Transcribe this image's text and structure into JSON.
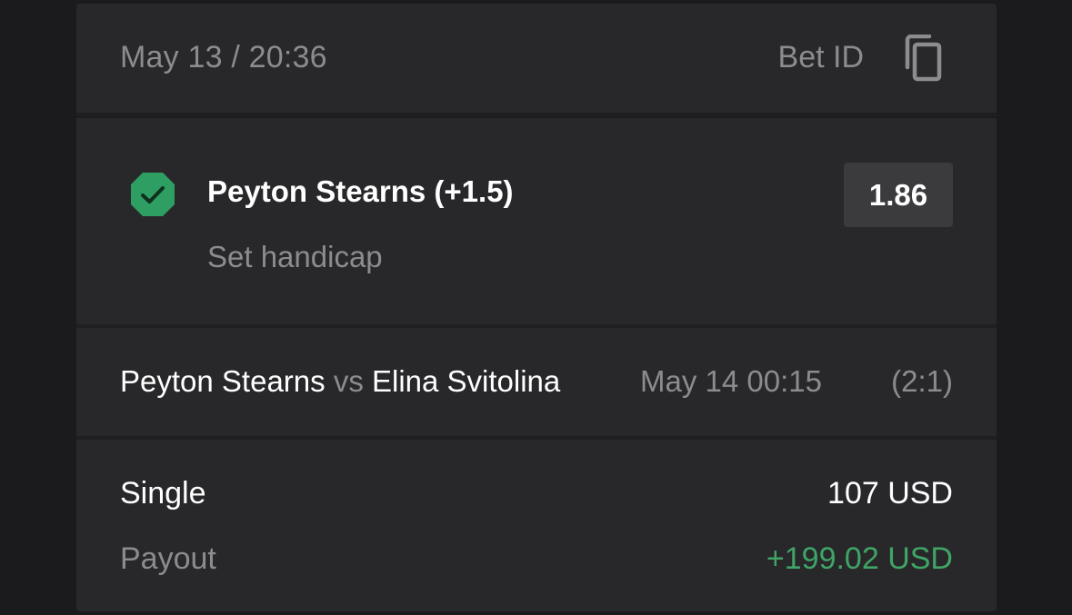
{
  "header": {
    "placed_at": "May 13 / 20:36",
    "bet_id_label": "Bet ID",
    "copy_icon": "copy-icon"
  },
  "selection": {
    "status_icon": "check-octagon-icon",
    "status_color": "#2e9e62",
    "name": "Peyton Stearns (+1.5)",
    "market": "Set handicap",
    "odds": "1.86"
  },
  "event": {
    "home": "Peyton Stearns",
    "vs": "vs",
    "away": "Elina Svitolina",
    "start": "May 14 00:15",
    "score": "(2:1)"
  },
  "stake": {
    "type_label": "Single",
    "amount": "107 USD",
    "payout_label": "Payout",
    "payout_value": "+199.02 USD",
    "payout_color": "#3fa466"
  }
}
